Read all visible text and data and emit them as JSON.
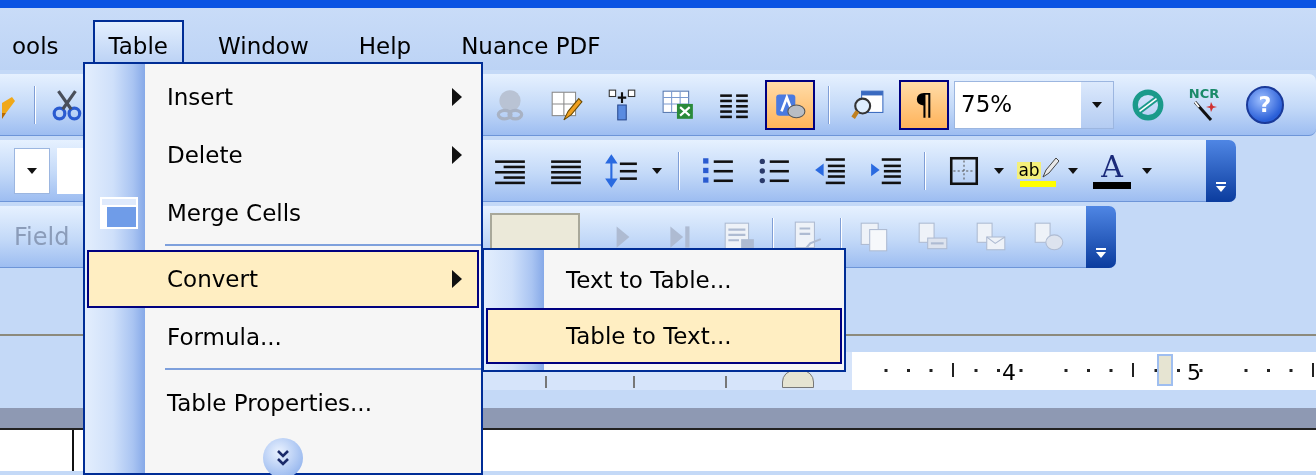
{
  "menu_bar": [
    {
      "label": "ools",
      "selected": false
    },
    {
      "label": "Table",
      "selected": true
    },
    {
      "label": "Window",
      "selected": false
    },
    {
      "label": "Help",
      "selected": false
    },
    {
      "label": "Nuance PDF",
      "selected": false
    }
  ],
  "standard_toolbar": {
    "buttons_before_zoom": [
      {
        "pressed": false
      },
      {
        "pressed": false
      },
      {
        "pressed": false
      },
      {
        "pressed": false
      },
      {
        "pressed": false
      },
      {
        "pressed": false
      },
      {
        "pressed": false
      },
      {
        "pressed": true
      },
      {
        "pressed": false
      },
      {
        "label": "¶",
        "pressed": true
      }
    ],
    "zoom": {
      "value": "75%"
    },
    "buttons_after_zoom": [
      {
        "pressed": false
      },
      {
        "label": "NCR",
        "pressed": false
      },
      {
        "label": "?",
        "pressed": false
      }
    ]
  },
  "formatting_toolbar": {
    "buttons": [
      {
        "dropdown": false
      },
      {
        "dropdown": false
      },
      {
        "dropdown": true
      },
      {
        "dropdown": false
      },
      {
        "dropdown": false
      },
      {
        "dropdown": false
      },
      {
        "dropdown": false
      },
      {
        "dropdown": true
      },
      {
        "label": "ab",
        "dropdown": true
      },
      {
        "label": "A",
        "dropdown": true
      }
    ]
  },
  "mail_merge_toolbar": {
    "field_label": "Field",
    "buttons": [
      {
        "disabled": true
      },
      {
        "disabled": true
      },
      {
        "disabled": true
      },
      {
        "disabled": true
      },
      {
        "disabled": true
      },
      {
        "disabled": true
      },
      {
        "disabled": true
      },
      {
        "disabled": true
      }
    ]
  },
  "table_menu": {
    "items": [
      {
        "kind": "item",
        "label": "Insert",
        "submenu": true,
        "icon": false,
        "selected": false
      },
      {
        "kind": "item",
        "label": "Delete",
        "submenu": true,
        "icon": false,
        "selected": false
      },
      {
        "kind": "item",
        "label": "Merge Cells",
        "submenu": false,
        "icon": true,
        "selected": false
      },
      {
        "kind": "separator"
      },
      {
        "kind": "item",
        "label": "Convert",
        "submenu": true,
        "icon": false,
        "selected": true
      },
      {
        "kind": "item",
        "label": "Formula...",
        "submenu": false,
        "icon": false,
        "selected": false
      },
      {
        "kind": "separator"
      },
      {
        "kind": "item",
        "label": "Table Properties...",
        "submenu": false,
        "icon": false,
        "selected": false
      },
      {
        "kind": "expand"
      }
    ]
  },
  "convert_submenu": {
    "items": [
      {
        "label": "Text to Table...",
        "selected": false
      },
      {
        "label": "Table to Text...",
        "selected": true
      }
    ]
  },
  "ruler": {
    "labels": [
      "4",
      "5"
    ]
  }
}
